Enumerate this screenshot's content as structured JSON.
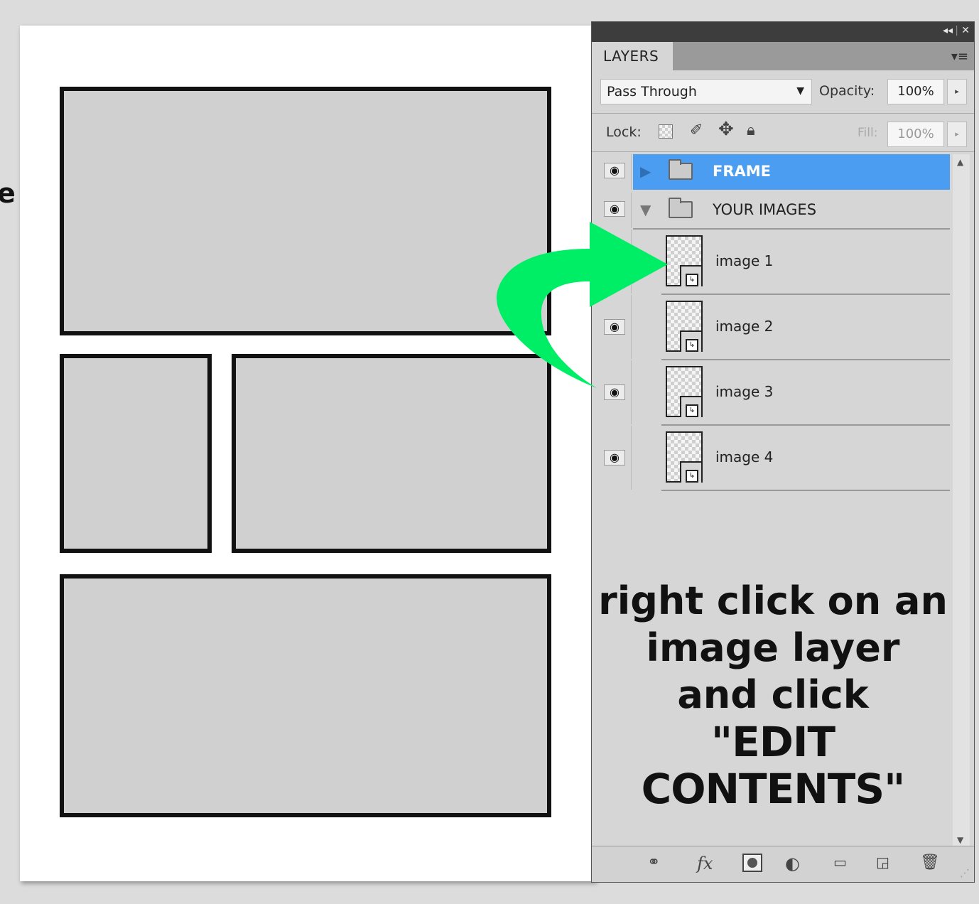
{
  "panel": {
    "tab_label": "LAYERS",
    "collapse_icon": "◂◂",
    "close_icon": "✕",
    "menu_icon": "▾≡"
  },
  "blend": {
    "mode": "Pass Through",
    "opacity_label": "Opacity:",
    "opacity_value": "100%"
  },
  "lock": {
    "label": "Lock:",
    "fill_label": "Fill:",
    "fill_value": "100%"
  },
  "layers": {
    "groups": [
      {
        "name": "FRAME",
        "selected": true,
        "expanded": false
      },
      {
        "name": "YOUR IMAGES",
        "selected": false,
        "expanded": true
      }
    ],
    "images": [
      {
        "name": "image 1",
        "visible": false
      },
      {
        "name": "image 2",
        "visible": true
      },
      {
        "name": "image 3",
        "visible": true
      },
      {
        "name": "image 4",
        "visible": true
      }
    ]
  },
  "instruction": {
    "line1": "right click on an",
    "line2": "image layer",
    "line3": "and click",
    "line4": "\"EDIT CONTENTS\""
  },
  "colors": {
    "selection": "#4a9df0",
    "arrow": "#00ee66",
    "slot_fill": "#d0d0d0"
  }
}
